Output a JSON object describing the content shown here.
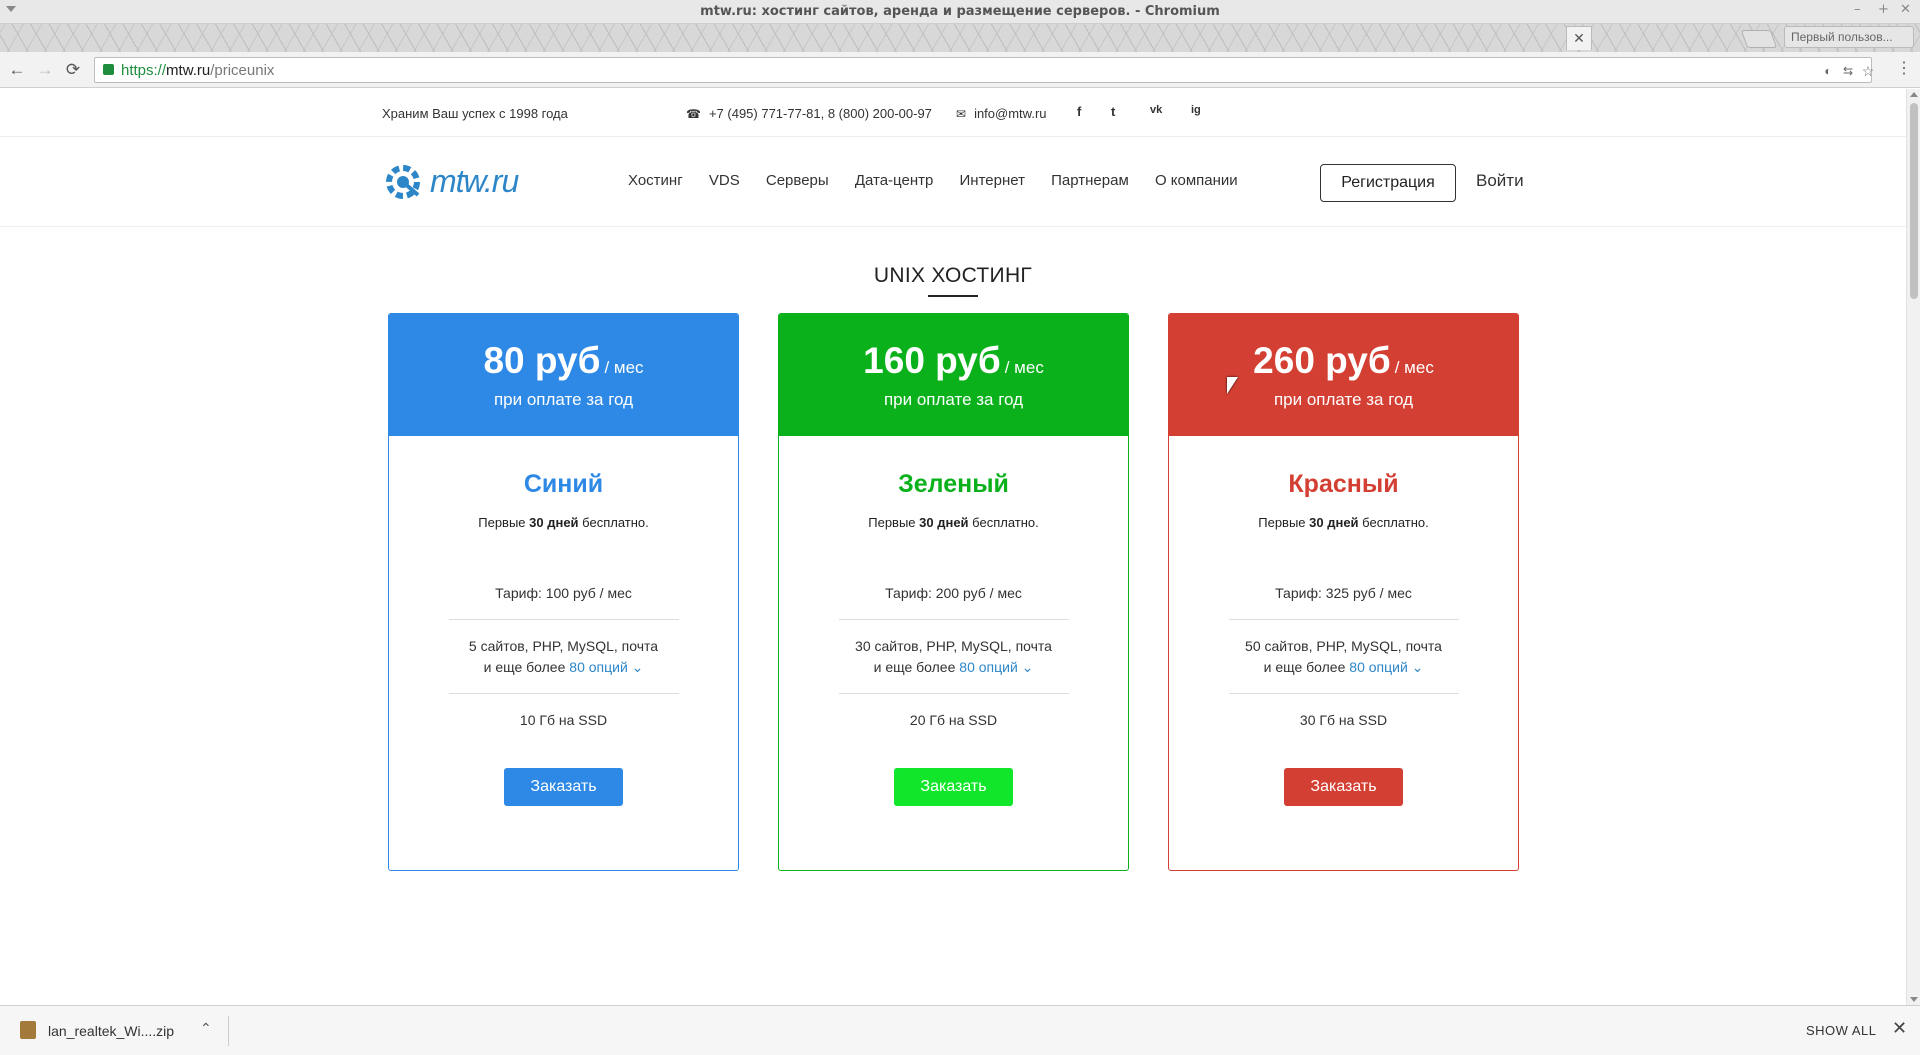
{
  "window": {
    "title": "mtw.ru: хостинг сайтов, аренда и размещение серверов. - Chromium",
    "min": "–",
    "max": "+",
    "close": "✕",
    "profile": "Первый пользов..."
  },
  "tab": {
    "close_icon": "✕"
  },
  "toolbar": {
    "back": "←",
    "forward": "→",
    "reload": "⟳",
    "url_scheme": "https://",
    "url_host": "mtw.ru",
    "url_path": "/priceunix",
    "menu": "⋮"
  },
  "topbar": {
    "slogan": "Храним Ваш успех с 1998 года",
    "phone": "+7 (495) 771-77-81, 8 (800) 200-00-97",
    "email": "info@mtw.ru",
    "phone_icon": "☎",
    "mail_icon": "✉",
    "social": [
      "f",
      "t",
      "vk",
      "ig"
    ]
  },
  "header": {
    "logo_text": "mtw.ru",
    "nav": [
      "Хостинг",
      "VDS",
      "Серверы",
      "Дата-центр",
      "Интернет",
      "Партнерам",
      "О компании"
    ],
    "register": "Регистрация",
    "login": "Войти"
  },
  "section": {
    "title": "UNIX ХОСТИНГ"
  },
  "plans": [
    {
      "price": "80 руб",
      "per": "/ мес",
      "note": "при оплате за год",
      "name": "Синий",
      "trial_pre": "Первые ",
      "trial_bold": "30 дней",
      "trial_post": " бесплатно.",
      "tariff": "Тариф: 100 руб / мес",
      "features_1": "5 сайтов, PHP, MySQL, почта",
      "features_2": "и еще более ",
      "options": "80 опций ⌄",
      "disk": "10 Гб на SSD",
      "order": "Заказать",
      "color": "#2d89e5",
      "button_color": "#2d89e5"
    },
    {
      "price": "160 руб",
      "per": "/ мес",
      "note": "при оплате за год",
      "name": "Зеленый",
      "trial_pre": "Первые ",
      "trial_bold": "30 дней",
      "trial_post": " бесплатно.",
      "tariff": "Тариф: 200 руб / мес",
      "features_1": "30 сайтов, PHP, MySQL, почта",
      "features_2": "и еще более ",
      "options": "80 опций ⌄",
      "disk": "20 Гб на SSD",
      "order": "Заказать",
      "color": "#0ab11b",
      "button_color": "#12e62b"
    },
    {
      "price": "260 руб",
      "per": "/ мес",
      "note": "при оплате за год",
      "name": "Красный",
      "trial_pre": "Первые ",
      "trial_bold": "30 дней",
      "trial_post": " бесплатно.",
      "tariff": "Тариф: 325 руб / мес",
      "features_1": "50 сайтов, PHP, MySQL, почта",
      "features_2": "и еще более ",
      "options": "80 опций ⌄",
      "disk": "30 Гб на SSD",
      "order": "Заказать",
      "color": "#d43f33",
      "button_color": "#d43f33"
    }
  ],
  "downloads": {
    "file": "lan_realtek_Wi....zip",
    "chevron": "⌃",
    "show_all": "SHOW ALL",
    "close": "✕"
  }
}
